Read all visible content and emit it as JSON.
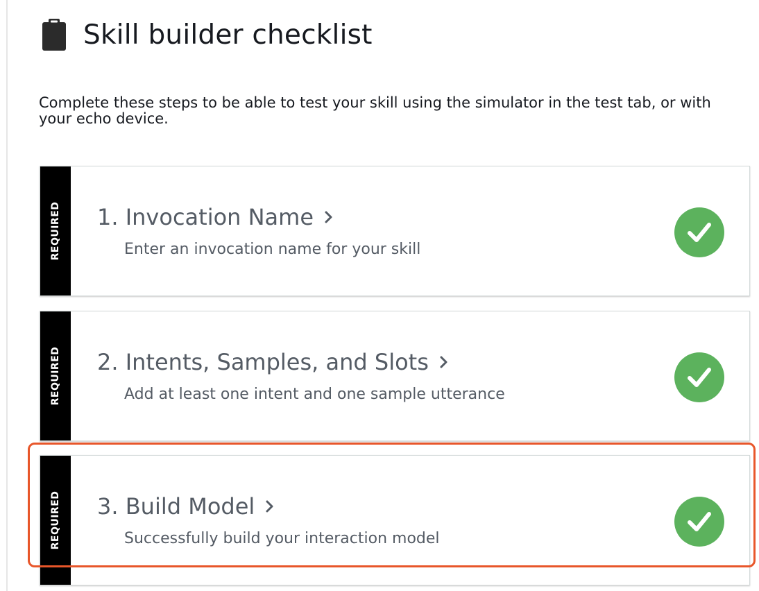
{
  "header": {
    "title": "Skill builder checklist",
    "icon": "clipboard-icon"
  },
  "intro": "Complete these steps to be able to test your skill using the simulator in the test tab, or with your echo device.",
  "steps": [
    {
      "badge": "REQUIRED",
      "title": "1. Invocation Name",
      "description": "Enter an invocation name for your skill",
      "complete": true
    },
    {
      "badge": "REQUIRED",
      "title": "2. Intents, Samples, and Slots",
      "description": "Add at least one intent and one sample utterance",
      "complete": true
    },
    {
      "badge": "REQUIRED",
      "title": "3. Build Model",
      "description": "Successfully build your interaction model",
      "complete": true
    }
  ],
  "colors": {
    "check_green": "#5cb25d",
    "highlight": "#e8562a",
    "badge_bg": "#000000"
  },
  "highlighted_step": 3
}
